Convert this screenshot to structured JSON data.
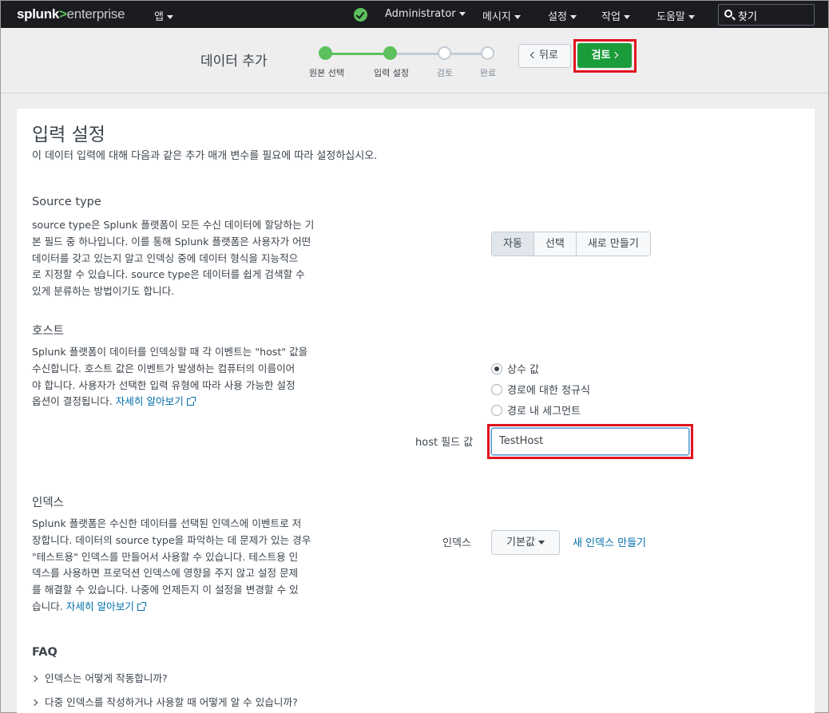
{
  "topbar": {
    "logo": {
      "prefix": "splunk",
      "arrow": ">",
      "suffix": "enterprise"
    },
    "apps_label": "앱",
    "user_label": "Administrator",
    "messages_label": "메시지",
    "settings_label": "설정",
    "activity_label": "작업",
    "help_label": "도움말",
    "search_label": "찾기",
    "status_color": "#5cc05c"
  },
  "wizard": {
    "title": "데이터 추가",
    "steps": [
      {
        "label": "원본 선택",
        "state": "done"
      },
      {
        "label": "입력 설정",
        "state": "current"
      },
      {
        "label": "검토",
        "state": "todo"
      },
      {
        "label": "완료",
        "state": "todo"
      }
    ],
    "back_label": "뒤로",
    "review_label": "검토",
    "accent": "#1a9c3b"
  },
  "page": {
    "title": "입력 설정",
    "subtitle": "이 데이터 입력에 대해 다음과 같은 추가 매개 변수를 필요에 따라 설정하십시오."
  },
  "source_type": {
    "title": "Source type",
    "lines": [
      "source type은 Splunk 플랫폼이 모든 수신 데이터에 할당하는 기",
      "본 필드 중 하나입니다. 이를 통해 Splunk 플랫폼은 사용자가 어떤",
      "데이터를 갖고 있는지 알고 인덱싱 중에 데이터 형식을 지능적으",
      "로 지정할 수 있습니다. source type은 데이터를 쉽게 검색할 수",
      "있게 분류하는 방법이기도 합니다."
    ],
    "options": [
      "자동",
      "선택",
      "새로 만들기"
    ],
    "selected": "자동"
  },
  "host": {
    "title": "호스트",
    "lines": [
      "Splunk 플랫폼이 데이터를 인덱싱할 때 각 이벤트는 \"host\" 값을",
      "수신합니다. 호스트 값은 이벤트가 발생하는 컴퓨터의 이름이어",
      "야 합니다. 사용자가 선택한 입력 유형에 따라 사용 가능한 설정"
    ],
    "last_line": "옵션이 결정됩니다.",
    "learn_more": "자세히 알아보기",
    "radios": [
      {
        "label": "상수 값",
        "checked": true
      },
      {
        "label": "경로에 대한 정규식",
        "checked": false
      },
      {
        "label": "경로 내 세그먼트",
        "checked": false
      }
    ],
    "field_label": "host 필드 값",
    "field_value": "TestHost"
  },
  "index": {
    "title": "인덱스",
    "lines": [
      "Splunk 플랫폼은 수신한 데이터를 선택된 인덱스에 이벤트로 저",
      "장합니다. 데이터의 source type을 파악하는 데 문제가 있는 경우",
      "\"테스트용\" 인덱스를 만들어서 사용할 수 있습니다. 테스트용 인",
      "덱스를 사용하면 프로덕션 인덱스에 영향을 주지 않고 설정 문제",
      "를 해결할 수 있습니다. 나중에 언제든지 이 설정을 변경할 수 있"
    ],
    "last_line": "습니다.",
    "learn_more": "자세히 알아보기",
    "field_label": "인덱스",
    "dropdown_value": "기본값",
    "new_index_link": "새 인덱스 만들기"
  },
  "faq": {
    "title": "FAQ",
    "items": [
      "인덱스는 어떻게 작동합니까?",
      "다중 인덱스를 작성하거나 사용할 때 어떻게 알 수 있습니까?"
    ]
  }
}
